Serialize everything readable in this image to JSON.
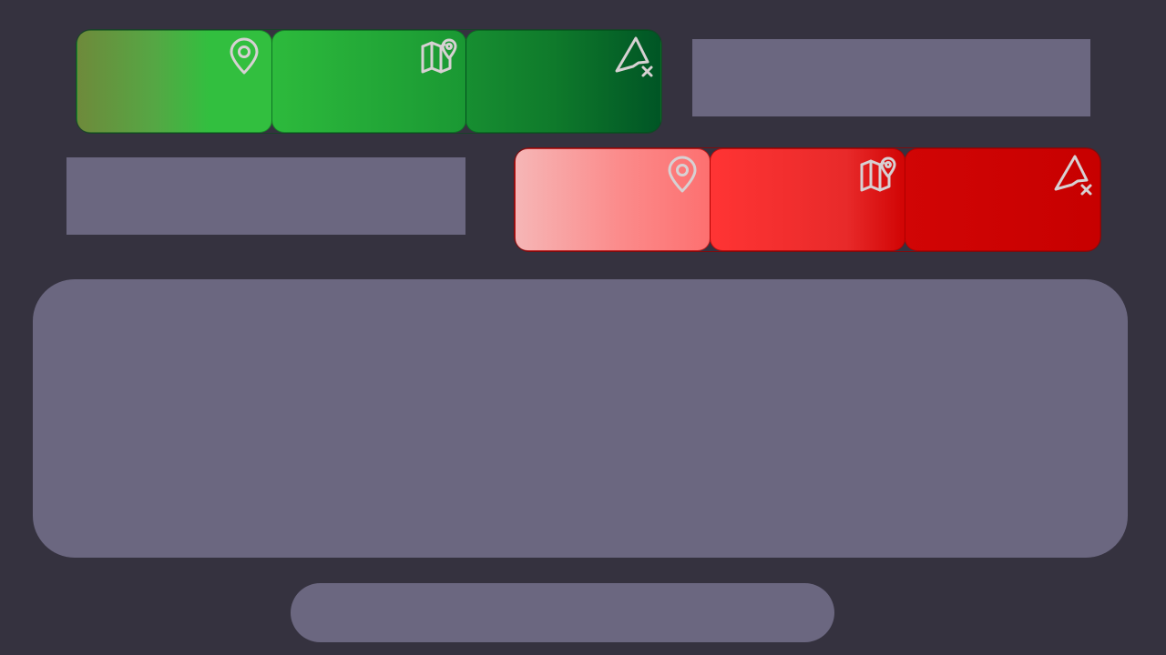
{
  "colors": {
    "background": "#35323f",
    "panel": "#6b6780",
    "icon_stroke": "#d7d1d3",
    "green_light": "#32bf3f",
    "green_dark": "#005525",
    "red_light": "#f6b6b6",
    "red_dark": "#c70000"
  },
  "groups": [
    {
      "name": "green",
      "segments": [
        {
          "icon": "map-pin-icon"
        },
        {
          "icon": "map-marker-icon"
        },
        {
          "icon": "navigation-off-icon"
        }
      ]
    },
    {
      "name": "red",
      "segments": [
        {
          "icon": "map-pin-icon"
        },
        {
          "icon": "map-marker-icon"
        },
        {
          "icon": "navigation-off-icon"
        }
      ]
    }
  ]
}
